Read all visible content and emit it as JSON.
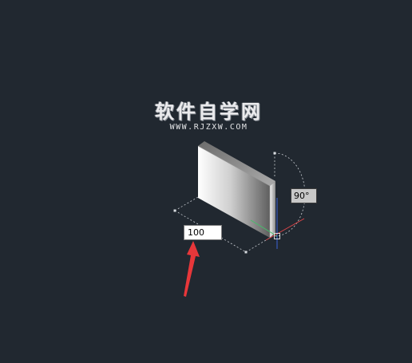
{
  "watermark": {
    "title": "软件自学网",
    "url": "WWW.RJZXW.COM"
  },
  "dimension_input": {
    "value": "100"
  },
  "angle_tooltip": {
    "value": "90°"
  },
  "colors": {
    "background": "#212830",
    "arrow": "#e8373a",
    "axis_x": "#e0464a",
    "axis_y": "#44c06a",
    "axis_z": "#3c64d8",
    "guide": "#c8ccd2"
  },
  "icons": {
    "cursor": "crosshair-cursor-icon",
    "pointer": "red-arrow-icon"
  }
}
